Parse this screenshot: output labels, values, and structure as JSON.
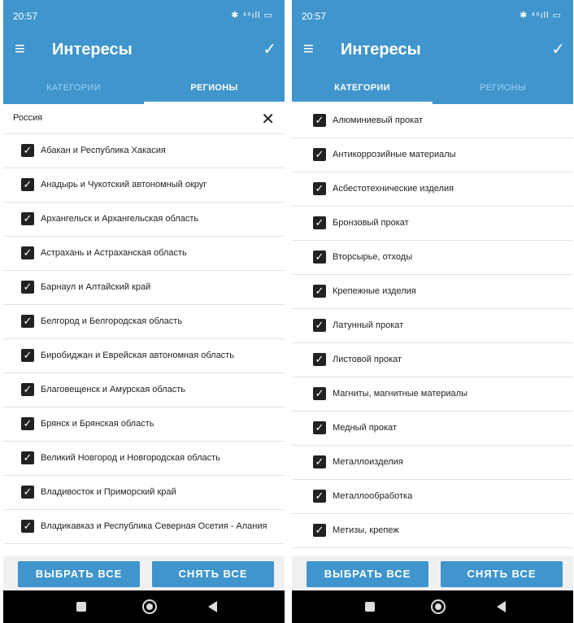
{
  "left_screen": {
    "status": {
      "time": "20:57",
      "icons": "✱ ⁴⁶ıll ▭"
    },
    "appbar": {
      "title": "Интересы"
    },
    "tabs": [
      {
        "label": "КАТЕГОРИИ",
        "active": false
      },
      {
        "label": "РЕГИОНЫ",
        "active": true
      }
    ],
    "filter": {
      "text": "Россия"
    },
    "items": [
      "Абакан и Республика Хакасия",
      "Анадырь и Чукотский автономный округ",
      "Архангельск и Архангельская область",
      "Астрахань и Астраханская область",
      "Барнаул и Алтайский край",
      "Белгород и Белгородская область",
      "Биробиджан и Еврейская автономная область",
      "Благовещенск и Амурская область",
      "Брянск и Брянская область",
      "Великий Новгород и Новгородская область",
      "Владивосток и Приморский край",
      "Владикавказ и Республика Северная Осетия - Алания"
    ],
    "buttons": {
      "select_all": "ВЫБРАТЬ ВСЕ",
      "clear_all": "СНЯТЬ ВСЕ"
    }
  },
  "right_screen": {
    "status": {
      "time": "20:57",
      "icons": "✱ ⁴⁶ıll ▭"
    },
    "appbar": {
      "title": "Интересы"
    },
    "tabs": [
      {
        "label": "КАТЕГОРИИ",
        "active": true
      },
      {
        "label": "РЕГИОНЫ",
        "active": false
      }
    ],
    "items": [
      "Алюминиевый прокат",
      "Антикоррозийные материалы",
      "Асбестотехнические изделия",
      "Бронзовый прокат",
      "Вторсырье, отходы",
      "Крепежные изделия",
      "Латунный прокат",
      "Листовой прокат",
      "Магниты, магнитные материалы",
      "Медный прокат",
      "Металлоизделия",
      "Металлообработка",
      "Метизы, крепеж"
    ],
    "buttons": {
      "select_all": "ВЫБРАТЬ ВСЕ",
      "clear_all": "СНЯТЬ ВСЕ"
    }
  },
  "colors": {
    "primary": "#3f95cc",
    "tab_inactive": "#9fd0ef",
    "checkbox": "#222222"
  },
  "icons": {
    "menu": "menu-icon",
    "confirm": "check-icon",
    "close": "close-icon",
    "checkbox": "checkbox-checked-icon"
  }
}
